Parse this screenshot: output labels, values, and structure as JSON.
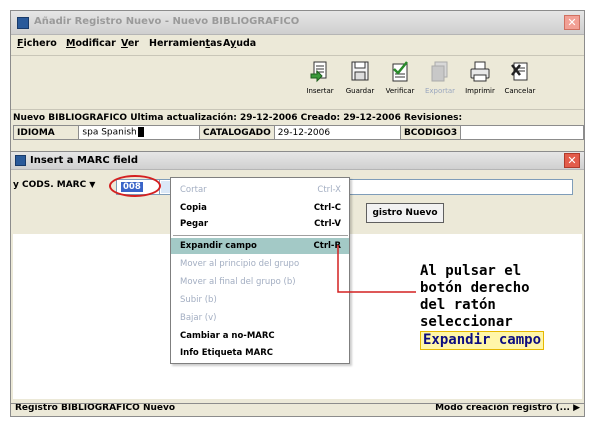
{
  "main_window": {
    "title": "Añadir Registro Nuevo - Nuevo BIBLIOGRAFICO",
    "close_glyph": "✕",
    "menu": [
      {
        "label_pre": "",
        "label_ul": "F",
        "label_post": "ichero"
      },
      {
        "label_pre": "",
        "label_ul": "M",
        "label_post": "odificar"
      },
      {
        "label_pre": "",
        "label_ul": "V",
        "label_post": "er"
      },
      {
        "label_pre": "Herramien",
        "label_ul": "t",
        "label_post": "as"
      },
      {
        "label_pre": "A",
        "label_ul": "y",
        "label_post": "uda"
      }
    ],
    "toolbar": [
      {
        "label": "Insertar",
        "icon": "insert-icon",
        "enabled": true
      },
      {
        "label": "Guardar",
        "icon": "save-icon",
        "enabled": true
      },
      {
        "label": "Verificar",
        "icon": "verify-icon",
        "enabled": true
      },
      {
        "label": "Exportar",
        "icon": "export-icon",
        "enabled": false
      },
      {
        "label": "Imprimir",
        "icon": "print-icon",
        "enabled": true
      },
      {
        "label": "Cancelar",
        "icon": "cancel-icon",
        "enabled": true
      }
    ],
    "record_info": "Nuevo BIBLIOGRAFICO   Ultima actualización: 29-12-2006    Creado: 29-12-2006     Revisiones:",
    "fields": [
      {
        "label": "IDIOMA",
        "value": "spa  Spanish"
      },
      {
        "label": "CATALOGADO",
        "value": "29-12-2006"
      },
      {
        "label": "BCODIGO3",
        "value": ""
      }
    ],
    "status_left": "Registro BIBLIOGRAFICO Nuevo",
    "status_right": "Modo creación registro (..."
  },
  "dialog": {
    "title": "Insert a MARC field",
    "close_glyph": "✕",
    "code_select": "y CODS. MARC",
    "field_tag": "008",
    "new_record_button": "gistro Nuevo"
  },
  "context_menu": {
    "items": [
      {
        "label": "Cortar",
        "shortcut": "Ctrl-X",
        "state": "disabled"
      },
      {
        "label": "Copia",
        "shortcut": "Ctrl-C",
        "state": "enabled"
      },
      {
        "label": "Pegar",
        "shortcut": "Ctrl-V",
        "state": "enabled"
      },
      {
        "label": "Expandir campo",
        "shortcut": "Ctrl-R",
        "state": "selected"
      },
      {
        "label": "Mover al principio del grupo",
        "shortcut": "",
        "state": "disabled"
      },
      {
        "label": "Mover al final del grupo (b)",
        "shortcut": "",
        "state": "disabled"
      },
      {
        "label": "Subir (b)",
        "shortcut": "",
        "state": "disabled"
      },
      {
        "label": "Bajar (v)",
        "shortcut": "",
        "state": "disabled"
      },
      {
        "label": "Cambiar a no-MARC",
        "shortcut": "",
        "state": "enabled"
      },
      {
        "label": "Info Etiqueta MARC",
        "shortcut": "",
        "state": "enabled"
      }
    ]
  },
  "annotation": {
    "line1": "Al pulsar el",
    "line2": "botón derecho",
    "line3": "del ratón",
    "line4": "seleccionar",
    "highlight": "Expandir campo"
  },
  "colors": {
    "selected_menu_bg": "#a3c9c6",
    "oval_red": "#d42020",
    "highlight_bg": "#fff6a8",
    "highlight_text": "#0d0d80"
  }
}
